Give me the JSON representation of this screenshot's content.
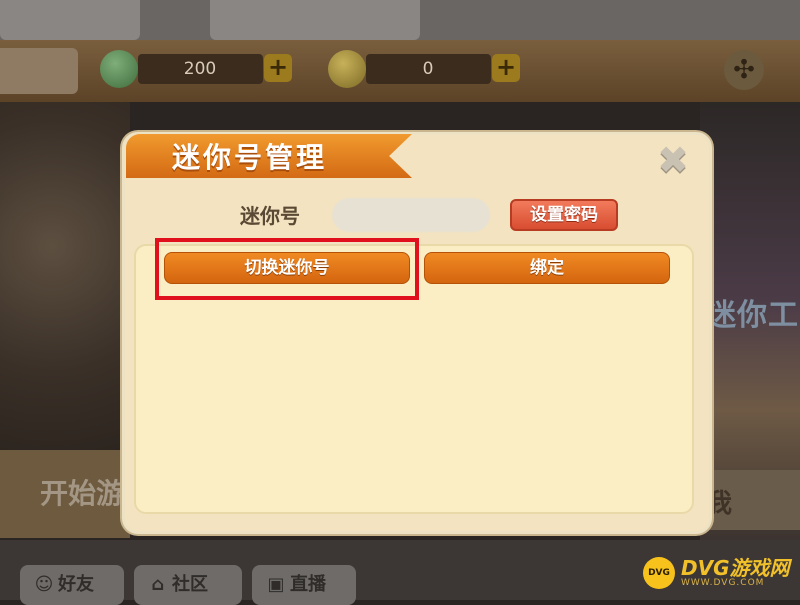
{
  "resources": {
    "gems": "200",
    "coins": "0",
    "plus": "+"
  },
  "background": {
    "right_text": "迷你工",
    "left_text": "开始游",
    "right_band_text": "我"
  },
  "dialog": {
    "title": "迷你号管理",
    "close_glyph": "✖",
    "mini_label": "迷你号",
    "mini_value": "",
    "set_password": "设置密码",
    "switch_account": "切换迷你号",
    "bind": "绑定"
  },
  "bottom_nav": [
    {
      "label": "好友",
      "icon": "friend-icon"
    },
    {
      "label": "社区",
      "icon": "home-icon"
    },
    {
      "label": "直播",
      "icon": "tv-icon"
    }
  ],
  "watermark": {
    "logo": "DVG",
    "main": "DVG游戏网",
    "sub": "WWW.DVG.COM"
  },
  "colors": {
    "accent_orange": "#d4650f",
    "password_red": "#d84d31",
    "highlight_red": "#e0101c",
    "panel_cream": "#fbeec4"
  }
}
